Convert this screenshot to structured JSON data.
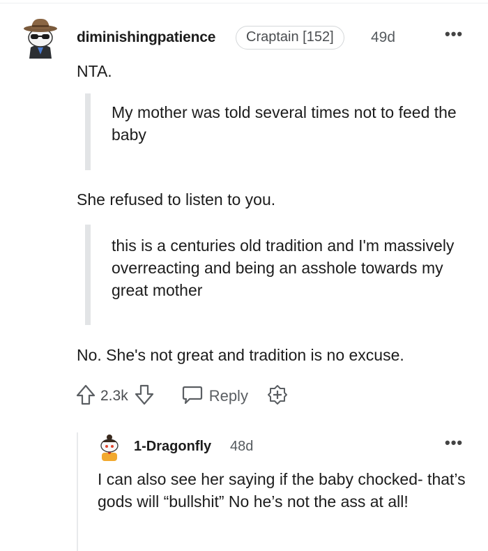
{
  "comment": {
    "username": "diminishingpatience",
    "flair": "Craptain [152]",
    "age": "49d",
    "more_menu": "•••",
    "avatar_icon": "cowboy-snoo-avatar-icon",
    "paragraphs": {
      "p1": "NTA.",
      "quote1": "My mother was told several times not to feed the baby",
      "p2": "She refused to listen to you.",
      "quote2": "this is a centuries old tradition and I'm massively overreacting and being an asshole towards my great mother",
      "p3": "No. She's not great and tradition is no excuse."
    },
    "actions": {
      "score": "2.3k",
      "reply_label": "Reply",
      "upvote_icon": "upvote-arrow-icon",
      "downvote_icon": "downvote-arrow-icon",
      "reply_icon": "speech-bubble-icon",
      "award_icon": "award-plus-icon"
    }
  },
  "reply": {
    "username": "1-Dragonfly",
    "age": "48d",
    "more_menu": "•••",
    "avatar_icon": "snoo-avatar-icon",
    "text": "I can also see her saying if the baby chocked- that’s gods will “bullshit” No he’s not the ass at all!"
  },
  "colors": {
    "text": "#1c1c1c",
    "meta": "#555a5e",
    "quote_bar": "#e2e4e6",
    "thread_line": "#e8eaec"
  }
}
